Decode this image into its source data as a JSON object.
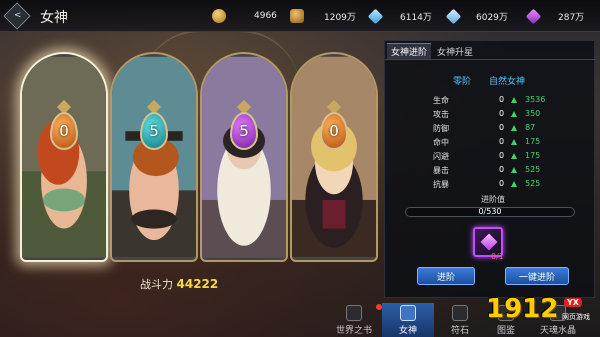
{
  "header": {
    "title": "女神",
    "back_label": "<"
  },
  "resources": [
    {
      "icon": "coin-icon",
      "value": "4966"
    },
    {
      "icon": "gold-ingot-icon",
      "value": "1209万"
    },
    {
      "icon": "crystal-icon",
      "value": "6114万"
    },
    {
      "icon": "diamond-icon",
      "value": "6029万"
    },
    {
      "icon": "purple-gem-icon",
      "value": "287万"
    }
  ],
  "goddesses": [
    {
      "level": "0",
      "orb_color": "orange",
      "selected": true
    },
    {
      "level": "5",
      "orb_color": "teal",
      "selected": false
    },
    {
      "level": "5",
      "orb_color": "purple",
      "selected": false
    },
    {
      "level": "0",
      "orb_color": "orange",
      "selected": false
    }
  ],
  "power": {
    "label": "战斗力",
    "value": "44222"
  },
  "panel": {
    "tabs": [
      "女神进阶",
      "女神升星"
    ],
    "stage": "零阶",
    "name": "自然女神",
    "stats": [
      {
        "label": "生命",
        "value": "0",
        "increase": "3536"
      },
      {
        "label": "攻击",
        "value": "0",
        "increase": "350"
      },
      {
        "label": "防御",
        "value": "0",
        "increase": "87"
      },
      {
        "label": "命中",
        "value": "0",
        "increase": "175"
      },
      {
        "label": "闪避",
        "value": "0",
        "increase": "175"
      },
      {
        "label": "暴击",
        "value": "0",
        "increase": "525"
      },
      {
        "label": "抗暴",
        "value": "0",
        "increase": "525"
      }
    ],
    "progress_label": "进阶值",
    "progress_text": "0/530",
    "progress_fraction": 0,
    "item_count": "0/1",
    "advance_button": "进阶",
    "one_click_button": "一键进阶"
  },
  "bottom_nav": [
    {
      "label": "世界之书",
      "icon": "book-icon",
      "active": false,
      "badge": true
    },
    {
      "label": "女神",
      "icon": "goddess-icon",
      "active": true,
      "badge": false
    },
    {
      "label": "符石",
      "icon": "rune-icon",
      "active": false,
      "badge": false
    },
    {
      "label": "图鉴",
      "icon": "album-icon",
      "active": false,
      "badge": false
    },
    {
      "label": "天魂水晶",
      "icon": "crystal-icon",
      "active": false,
      "badge": false
    }
  ],
  "watermark": {
    "number": "1912",
    "tag": "YX",
    "sub": "网页游戏"
  },
  "colors": {
    "accent_blue": "#3a7bd8",
    "increase_green": "#3fd46a",
    "power_yellow": "#f4d84a",
    "subhead_blue": "#57c3ff"
  }
}
